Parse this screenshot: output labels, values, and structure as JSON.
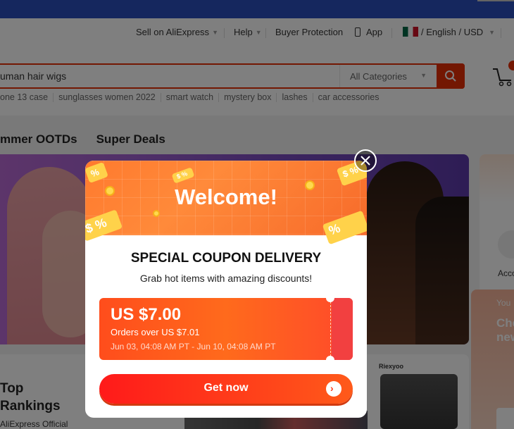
{
  "topbar": {
    "sell_label": "Sell on AliExpress",
    "help_label": "Help",
    "buyer_protection_label": "Buyer Protection",
    "app_label": "App",
    "locale_label": "/ English /",
    "currency_label": "USD"
  },
  "search": {
    "value": "uman hair wigs",
    "category_label": "All Categories"
  },
  "hotwords": [
    "one 13 case",
    "sunglasses women 2022",
    "smart watch",
    "mystery box",
    "lashes",
    "car accessories"
  ],
  "nav_tabs": [
    "mmer OOTDs",
    "Super Deals"
  ],
  "right_col": {
    "account_label": "Acco",
    "promo_line1": "You",
    "promo_line2": "Che new"
  },
  "bottom_card": {
    "title_line1": "Top",
    "title_line2": "Rankings",
    "subtitle": "AliExpress Official",
    "brand_label": "Riexyoo"
  },
  "modal": {
    "banner_title": "Welcome!",
    "heading": "SPECIAL COUPON DELIVERY",
    "subheading": "Grab hot items with amazing discounts!",
    "coupon": {
      "amount": "US $7.00",
      "condition": "Orders over US $7.01",
      "validity": "Jun 03, 04:08 AM PT - Jun 10, 04:08 AM PT"
    },
    "cta_label": "Get now",
    "banner_glyphs": [
      "%",
      "$ %",
      "$ %",
      "$ %",
      "%"
    ]
  },
  "colors": {
    "brand_red": "#e62e04",
    "topbar_blue": "#2b4fbd",
    "banner_orange": "#ff7a2e",
    "coupon_red": "#ff4d1c"
  },
  "icons": {
    "search": "search-icon",
    "cart": "cart-icon",
    "phone": "phone-icon",
    "flag": "mexico-flag-icon",
    "close": "close-icon",
    "arrow": "arrow-right-icon"
  }
}
